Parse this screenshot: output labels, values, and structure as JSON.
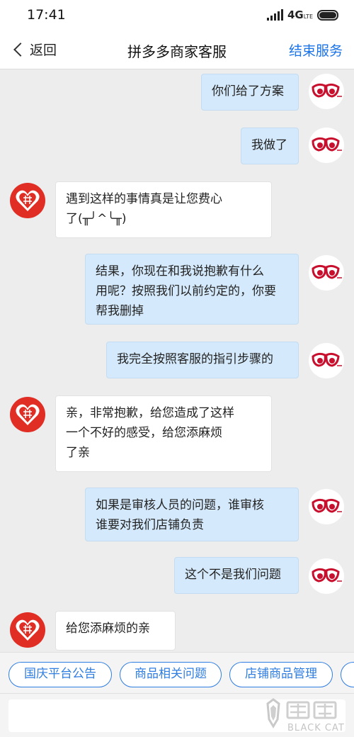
{
  "status": {
    "time": "17:41",
    "network": "4G",
    "network_sub": "LTE"
  },
  "header": {
    "back_label": "返回",
    "title": "拼多多商家客服",
    "end_label": "结束服务"
  },
  "messages": [
    {
      "side": "out",
      "text": "你们给了方案"
    },
    {
      "side": "out",
      "text": "我做了"
    },
    {
      "side": "in",
      "lines": [
        "遇到这样的事情真是让您费心",
        "了(╥╯^╰╥)"
      ]
    },
    {
      "side": "out",
      "lines": [
        "结果，你现在和我说抱歉有什么",
        "用呢？按照我们以前约定的，你要",
        "帮我删掉"
      ]
    },
    {
      "side": "out",
      "text": "我完全按照客服的指引步骤的"
    },
    {
      "side": "in",
      "lines": [
        "亲，非常抱歉，给您造成了这样",
        "一个不好的感受，给您添麻烦",
        "了亲"
      ]
    },
    {
      "side": "out",
      "lines": [
        "如果是审核人员的问题，谁审核",
        "谁要对我们店铺负责"
      ]
    },
    {
      "side": "out",
      "text": "这个不是我们问题"
    },
    {
      "side": "in",
      "text": "给您添麻烦的亲"
    }
  ],
  "quick_replies": [
    "国庆平台公告",
    "商品相关问题",
    "店铺商品管理"
  ],
  "input": {
    "placeholder": ""
  },
  "watermark": {
    "text_cn": "黑猫",
    "text_en": "BLACK CAT"
  },
  "colors": {
    "accent": "#1a73e8",
    "bubble_out": "#d4e9fb",
    "pdd_red": "#e02e24"
  }
}
